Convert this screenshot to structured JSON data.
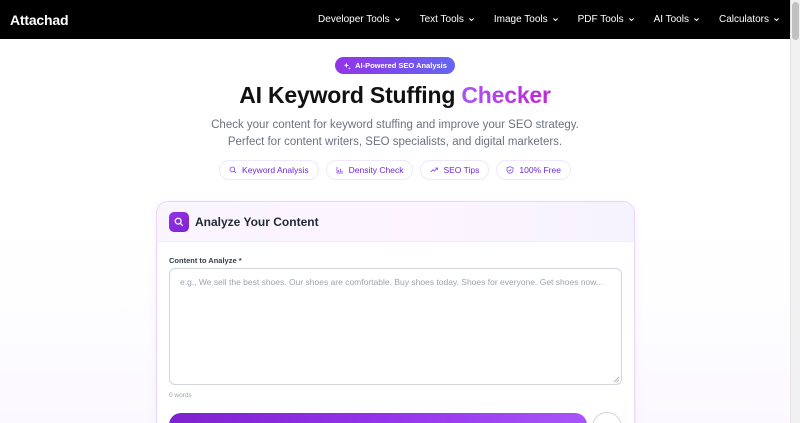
{
  "brand": {
    "logo": "Attachad"
  },
  "nav": {
    "items": [
      {
        "label": "Developer Tools"
      },
      {
        "label": "Text Tools"
      },
      {
        "label": "Image Tools"
      },
      {
        "label": "PDF Tools"
      },
      {
        "label": "AI Tools"
      },
      {
        "label": "Calculators"
      }
    ]
  },
  "hero": {
    "badge": "AI-Powered SEO Analysis",
    "title_main": "AI Keyword Stuffing ",
    "title_accent": "Checker",
    "subtitle_line1": "Check your content for keyword stuffing and improve your SEO strategy.",
    "subtitle_line2": "Perfect for content writers, SEO specialists, and digital marketers.",
    "pills": [
      {
        "label": "Keyword Analysis",
        "icon": "search-icon"
      },
      {
        "label": "Density Check",
        "icon": "bar-chart-icon"
      },
      {
        "label": "SEO Tips",
        "icon": "trending-up-icon"
      },
      {
        "label": "100% Free",
        "icon": "shield-check-icon"
      }
    ]
  },
  "analyzer": {
    "title": "Analyze Your Content",
    "content_label": "Content to Analyze *",
    "content_value": "",
    "content_placeholder": "e.g., We sell the best shoes. Our shoes are comfortable. Buy shoes today. Shoes for everyone. Get shoes now...",
    "word_count": "0 words"
  },
  "colors": {
    "accent_purple": "#9333ea",
    "accent_indigo": "#6366f1",
    "nav_bg": "#000000"
  }
}
